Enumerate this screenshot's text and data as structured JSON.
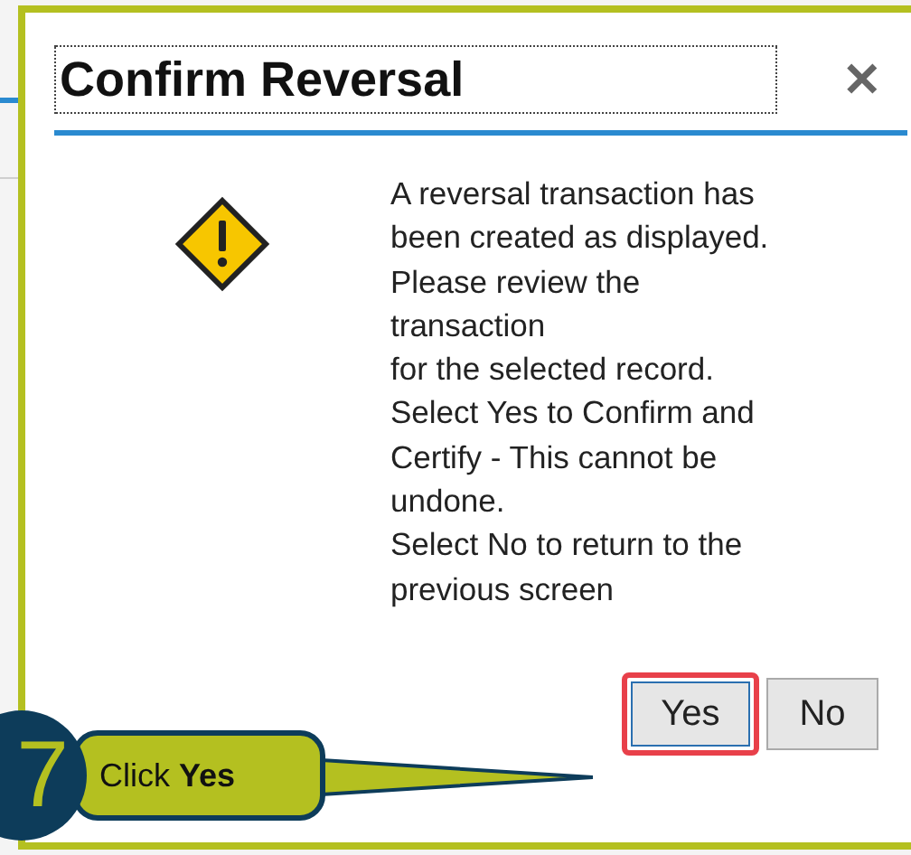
{
  "dialog": {
    "title": "Confirm Reversal",
    "close": "✕",
    "message_lines": [
      "A reversal transaction has",
      "been created as displayed.",
      "Please review the",
      "transaction",
      "for the selected record.",
      "Select Yes to Confirm and",
      "Certify - This cannot be",
      "undone.",
      "Select No to return to the",
      "previous screen"
    ],
    "buttons": [
      {
        "label": "Yes",
        "highlighted": true
      },
      {
        "label": "No",
        "highlighted": false
      }
    ]
  },
  "callout": {
    "step": "7",
    "text": "Click **Yes**"
  }
}
